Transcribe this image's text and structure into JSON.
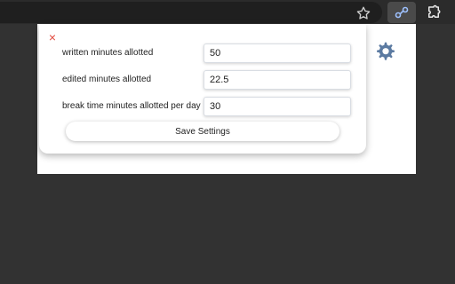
{
  "browser": {
    "toolbar_color": "#2b2b2b",
    "icons": [
      "star-icon",
      "extension-active-icon",
      "puzzle-icon"
    ]
  },
  "settings": {
    "close_label": "×",
    "fields": [
      {
        "label": "written minutes allotted",
        "value": "50"
      },
      {
        "label": "edited minutes allotted",
        "value": "22.5"
      },
      {
        "label": "break time minutes allotted per day",
        "value": "30"
      }
    ],
    "save_label": "Save Settings"
  },
  "page": {
    "settings_icon": "gear-icon",
    "accent_color": "#5b7aa1"
  }
}
